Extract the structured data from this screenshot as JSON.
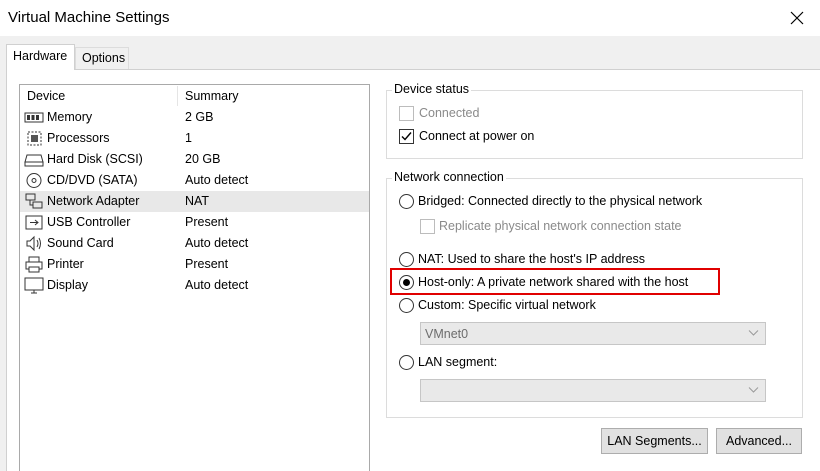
{
  "window": {
    "title": "Virtual Machine Settings"
  },
  "tabs": [
    {
      "label": "Hardware"
    },
    {
      "label": "Options"
    }
  ],
  "device_list": {
    "col_device": "Device",
    "col_summary": "Summary",
    "rows": [
      {
        "name": "Memory",
        "summary": "2 GB",
        "icon": "memory-icon"
      },
      {
        "name": "Processors",
        "summary": "1",
        "icon": "processor-icon"
      },
      {
        "name": "Hard Disk (SCSI)",
        "summary": "20 GB",
        "icon": "hard-disk-icon"
      },
      {
        "name": "CD/DVD (SATA)",
        "summary": "Auto detect",
        "icon": "cd-dvd-icon"
      },
      {
        "name": "Network Adapter",
        "summary": "NAT",
        "icon": "network-adapter-icon",
        "selected": true
      },
      {
        "name": "USB Controller",
        "summary": "Present",
        "icon": "usb-icon"
      },
      {
        "name": "Sound Card",
        "summary": "Auto detect",
        "icon": "sound-card-icon"
      },
      {
        "name": "Printer",
        "summary": "Present",
        "icon": "printer-icon"
      },
      {
        "name": "Display",
        "summary": "Auto detect",
        "icon": "display-icon"
      }
    ]
  },
  "device_status": {
    "legend": "Device status",
    "connected_label": "Connected",
    "connected_checked": false,
    "connected_disabled": true,
    "connect_power_label": "Connect at power on",
    "connect_power_checked": true
  },
  "network_connection": {
    "legend": "Network connection",
    "bridged_label": "Bridged: Connected directly to the physical network",
    "replicate_label": "Replicate physical network connection state",
    "nat_label": "NAT: Used to share the host's IP address",
    "hostonly_label": "Host-only: A private network shared with the host",
    "custom_label": "Custom: Specific virtual network",
    "custom_value": "VMnet0",
    "lan_label": "LAN segment:",
    "lan_value": "",
    "selected": "host-only"
  },
  "buttons": {
    "lan_segments": "LAN Segments...",
    "advanced": "Advanced..."
  },
  "colors": {
    "highlight": "#e00000",
    "selected_row": "#e8e8e8"
  }
}
